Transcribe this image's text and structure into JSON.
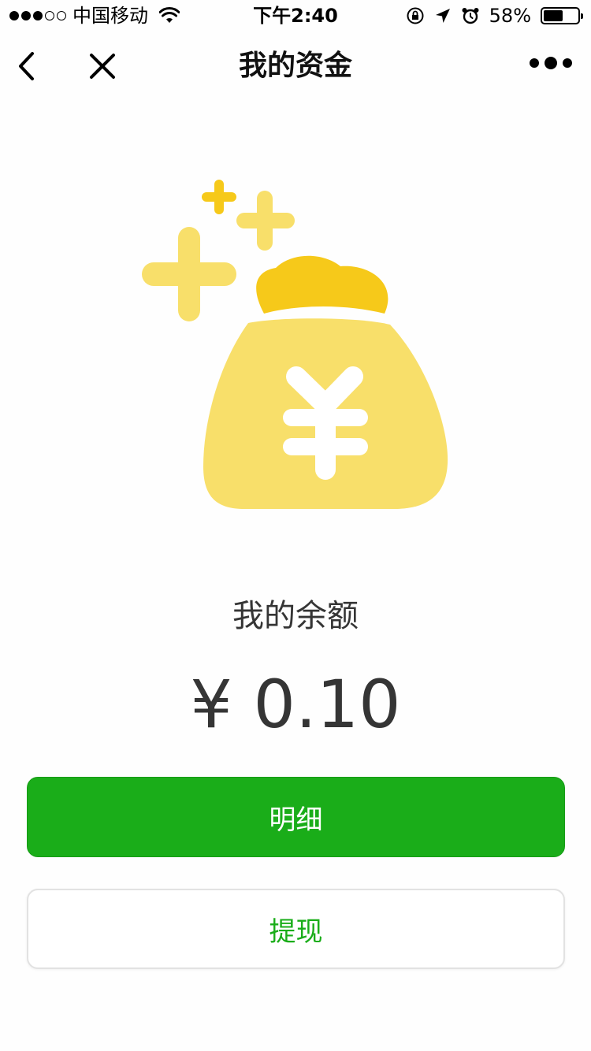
{
  "status_bar": {
    "carrier": "中国移动",
    "time": "下午2:40",
    "battery_percent": "58%",
    "battery_level": 0.58,
    "signal_strength": 3,
    "signal_max": 5
  },
  "nav": {
    "title": "我的资金",
    "back_icon": "chevron-left-icon",
    "close_icon": "close-icon",
    "more_icon": "more-dots-icon"
  },
  "illustration": {
    "icon": "money-bag-icon",
    "colors": {
      "bag": "#f8df6a",
      "knot": "#f6c91a",
      "sparkle_light": "#f8df6a",
      "sparkle_dark": "#f6c91a"
    }
  },
  "balance": {
    "label": "我的余额",
    "amount": "¥ 0.10"
  },
  "actions": {
    "details_label": "明细",
    "withdraw_label": "提现"
  },
  "colors": {
    "accent": "#1aad19",
    "text_primary": "#353535"
  }
}
